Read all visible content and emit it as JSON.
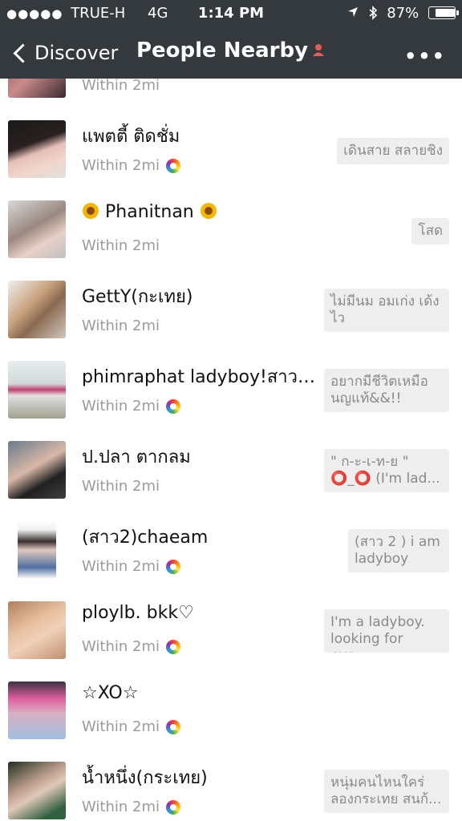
{
  "status_bar": {
    "signal_dots": "●●●●●",
    "carrier": "TRUE-H",
    "network": "4G",
    "time": "1:14 PM",
    "location_icon": "location-arrow-icon",
    "bluetooth_icon": "bluetooth-icon",
    "battery_text": "87%",
    "battery_level": 0.87
  },
  "navbar": {
    "back_label": "Discover",
    "title": "People Nearby",
    "more_label": "•••"
  },
  "list": [
    {
      "name": "",
      "distance": "Within 2mi",
      "bubble": "",
      "cam": false
    },
    {
      "name": "แพตตี้ ติดชั่ม",
      "distance": "Within 2mi",
      "bubble": "เดินสาย สลายชิง",
      "cam": true
    },
    {
      "name": "Phanitnan",
      "distance": "Within 2mi",
      "bubble": "โสด",
      "cam": false
    },
    {
      "name": "GettY(กะเทย)",
      "distance": "Within 2mi",
      "bubble": "ไม่มีนม อมเก่ง เด้งไว",
      "cam": false
    },
    {
      "name": "phimraphat ladyboy!สาวส...",
      "distance": "Within 2mi",
      "bubble": "อยากมีชีวิตเหมือนญแท้&&!!",
      "cam": true
    },
    {
      "name": "ป.ปลา ตากลม",
      "distance": "Within 2mi",
      "bubble": "\" ก-ะ-เ-ท-ย \" ⭕_⭕ (I'm lad...",
      "cam": false
    },
    {
      "name": "(สาว2)chaeam",
      "distance": "Within 2mi",
      "bubble": "(สาว 2 ) i am ladyboy",
      "cam": true
    },
    {
      "name": "ploylb. bkk♡",
      "distance": "Within 2mi",
      "bubble": "I'm a ladyboy. looking for eve...",
      "cam": true
    },
    {
      "name": "☆XO☆",
      "distance": "Within 2mi",
      "bubble": "",
      "cam": true
    },
    {
      "name": "น้ำหนึ่ง(กระเทย)",
      "distance": "Within 2mi",
      "bubble": "หนุ่มคนไหนใคร่ลองกระเทย สนก้...",
      "cam": true
    }
  ]
}
